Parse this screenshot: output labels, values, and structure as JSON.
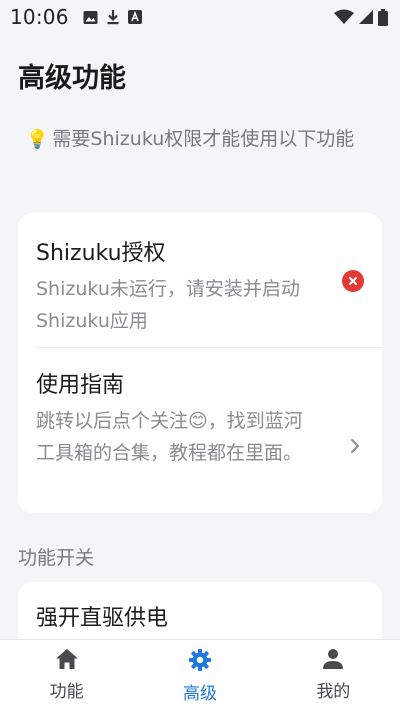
{
  "status_bar": {
    "time": "10:06",
    "notification_icons": [
      "image-icon",
      "download-icon",
      "font-icon"
    ],
    "system_icons": [
      "wifi-icon",
      "signal-icon",
      "battery-icon"
    ]
  },
  "page": {
    "title": "高级功能",
    "tip_icon": "💡",
    "tip_text": "需要Shizuku权限才能使用以下功能"
  },
  "card_main": {
    "rows": [
      {
        "title": "Shizuku授权",
        "description": "Shizuku未运行，请安装并启动Shizuku应用",
        "status_icon": "error-icon",
        "status_color": "#e53935"
      },
      {
        "title": "使用指南",
        "description": "跳转以后点个关注😊，找到蓝河工具箱的合集，教程都在里面。",
        "trailing_icon": "chevron-right-icon"
      }
    ]
  },
  "section": {
    "header": "功能开关"
  },
  "card_switches": {
    "rows": [
      {
        "title": "强开直驱供电"
      }
    ]
  },
  "bottom_nav": {
    "active_color": "#1f7ae0",
    "items": [
      {
        "label": "功能",
        "icon": "home-icon",
        "active": false
      },
      {
        "label": "高级",
        "icon": "gear-icon",
        "active": true
      },
      {
        "label": "我的",
        "icon": "person-icon",
        "active": false
      }
    ]
  }
}
